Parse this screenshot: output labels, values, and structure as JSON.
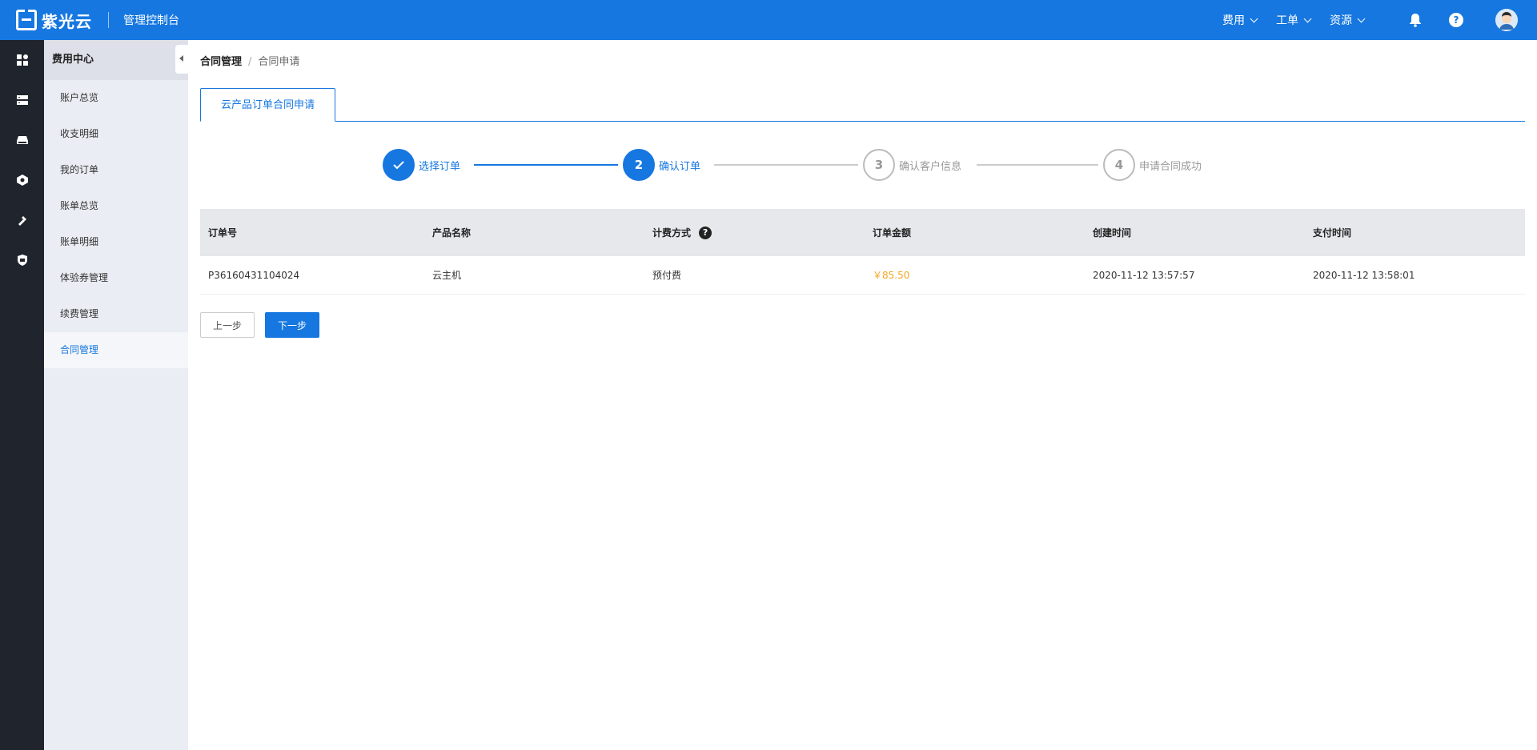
{
  "header": {
    "logo_text": "紫光云",
    "console_title": "管理控制台",
    "nav": [
      {
        "label": "费用"
      },
      {
        "label": "工单"
      },
      {
        "label": "资源"
      }
    ]
  },
  "rail": {
    "icons": [
      "dashboard-icon",
      "server-icon",
      "storage-icon",
      "network-icon",
      "tools-icon",
      "security-icon"
    ]
  },
  "submenu": {
    "title": "费用中心",
    "items": [
      {
        "label": "账户总览"
      },
      {
        "label": "收支明细"
      },
      {
        "label": "我的订单"
      },
      {
        "label": "账单总览"
      },
      {
        "label": "账单明细"
      },
      {
        "label": "体验券管理"
      },
      {
        "label": "续费管理"
      },
      {
        "label": "合同管理"
      }
    ],
    "active_index": 7
  },
  "breadcrumb": {
    "current": "合同管理",
    "separator": "/",
    "sub": "合同申请"
  },
  "tab": {
    "label": "云产品订单合同申请"
  },
  "steps": [
    {
      "number": "1",
      "label": "选择订单",
      "status": "done"
    },
    {
      "number": "2",
      "label": "确认订单",
      "status": "active"
    },
    {
      "number": "3",
      "label": "确认客户信息",
      "status": "wait"
    },
    {
      "number": "4",
      "label": "申请合同成功",
      "status": "wait"
    }
  ],
  "table": {
    "headers": [
      "订单号",
      "产品名称",
      "计费方式",
      "订单金额",
      "创建时间",
      "支付时间"
    ],
    "rows": [
      [
        "P36160431104024",
        "云主机",
        "预付费",
        "￥85.50",
        "2020-11-12 13:57:57",
        "2020-11-12 13:58:01"
      ]
    ]
  },
  "buttons": {
    "prev": "上一步",
    "next": "下一步"
  },
  "colors": {
    "primary": "#1677e0",
    "amount": "#f5a623",
    "rail_bg": "#20242d"
  }
}
